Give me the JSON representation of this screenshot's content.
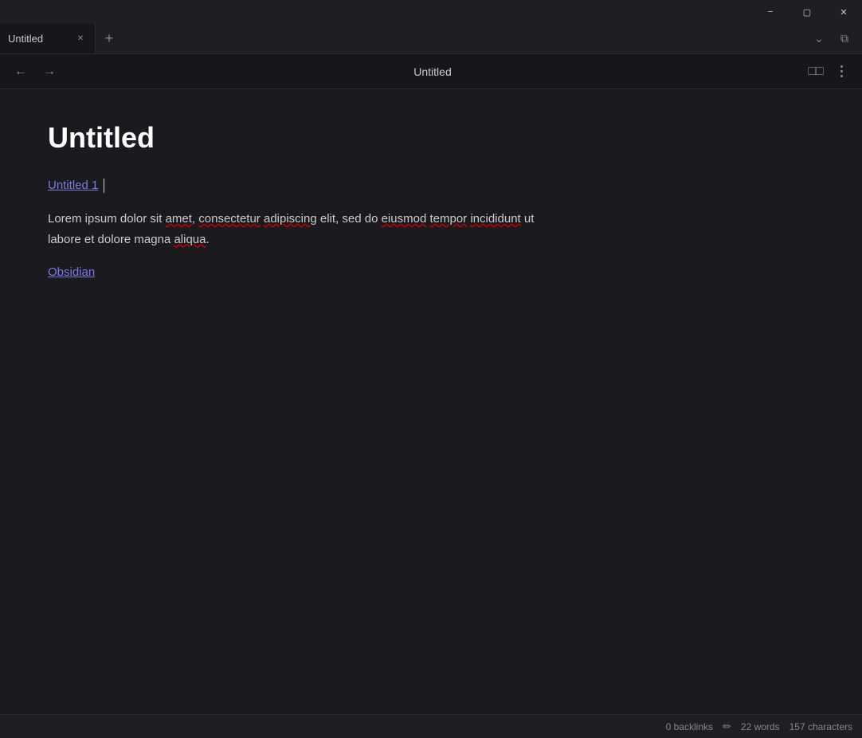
{
  "titlebar": {
    "minimize_label": "−",
    "maximize_label": "▢",
    "close_label": "✕"
  },
  "tabbar": {
    "tab_label": "Untitled",
    "tab_close_label": "✕",
    "new_tab_label": "+",
    "dropdown_label": "⌄",
    "split_label": "⧉"
  },
  "navbar": {
    "back_label": "←",
    "forward_label": "→",
    "title": "Untitled",
    "reader_label": "□□",
    "menu_label": "⋮"
  },
  "note": {
    "title": "Untitled",
    "link1": "Untitled 1",
    "body": "Lorem ipsum dolor sit amet, consectetur adipiscing elit, sed do eiusmod tempor incididunt ut labore et dolore magna aliqua.",
    "link2": "Obsidian",
    "spell_words": [
      "amet",
      "consectetur",
      "adipiscing",
      "eiusmod",
      "tempor",
      "incididunt",
      "aliqua"
    ]
  },
  "statusbar": {
    "backlinks": "0 backlinks",
    "edit_icon": "✏",
    "words": "22 words",
    "characters": "157 characters"
  }
}
